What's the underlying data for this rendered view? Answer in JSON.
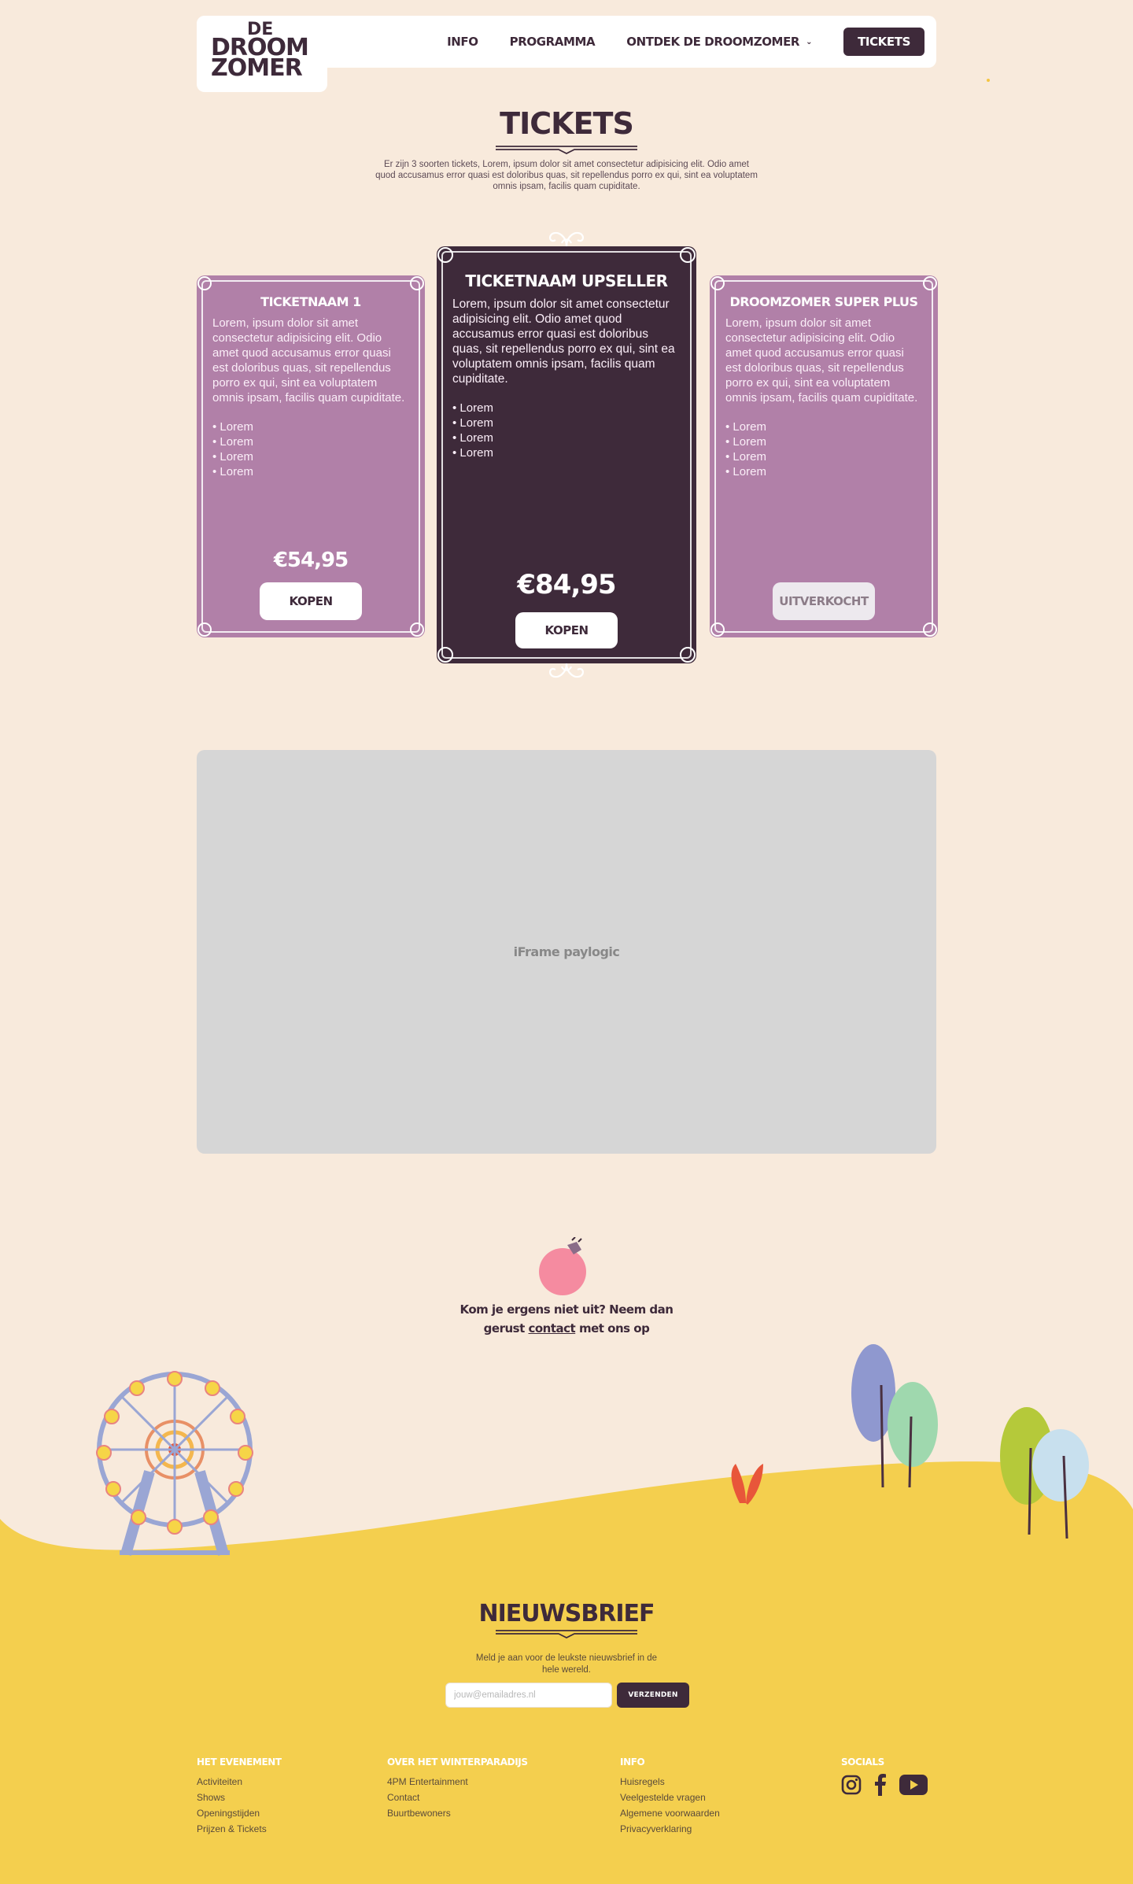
{
  "header": {
    "logo": {
      "line1": "DE",
      "line2": "DROOM",
      "line3": "ZOMER"
    },
    "nav": [
      {
        "label": "INFO"
      },
      {
        "label": "PROGRAMMA"
      },
      {
        "label": "ONTDEK DE DROOMZOMER"
      }
    ],
    "tickets_button": "TICKETS"
  },
  "tickets_section": {
    "title": "TICKETS",
    "intro": "Er zijn 3 soorten tickets, Lorem, ipsum dolor sit amet consectetur adipisicing elit. Odio amet quod accusamus error quasi est doloribus quas, sit repellendus porro ex qui, sint ea voluptatem omnis ipsam, facilis quam cupiditate."
  },
  "cards": [
    {
      "name": "TICKETNAAM 1",
      "description": "Lorem, ipsum dolor sit amet consectetur adipisicing elit. Odio amet quod accusamus error quasi est doloribus quas, sit repellendus porro ex qui, sint ea voluptatem omnis ipsam, facilis quam cupiditate.",
      "bullets": [
        "• Lorem",
        "• Lorem",
        "• Lorem",
        "• Lorem"
      ],
      "price": "€54,95",
      "button": "KOPEN"
    },
    {
      "name": "TICKETNAAM UPSELLER",
      "description": "Lorem, ipsum dolor sit amet consectetur adipisicing elit. Odio amet quod accusamus error quasi est doloribus quas, sit repellendus porro ex qui, sint ea voluptatem omnis ipsam, facilis quam cupiditate.",
      "bullets": [
        "• Lorem",
        "• Lorem",
        "• Lorem",
        "• Lorem"
      ],
      "price": "€84,95",
      "button": "KOPEN"
    },
    {
      "name": "DROOMZOMER SUPER PLUS",
      "description": "Lorem, ipsum dolor sit amet consectetur adipisicing elit. Odio amet quod accusamus error quasi est doloribus quas, sit repellendus porro ex qui, sint ea voluptatem omnis ipsam, facilis quam cupiditate.",
      "bullets": [
        "• Lorem",
        "• Lorem",
        "• Lorem",
        "• Lorem"
      ],
      "price": "",
      "button": "UITVERKOCHT"
    }
  ],
  "iframe": {
    "label": "iFrame paylogic"
  },
  "contact": {
    "line1": "Kom je ergens niet uit? Neem dan",
    "prefix": "gerust ",
    "link": "contact",
    "suffix": " met ons op"
  },
  "newsletter": {
    "title": "NIEUWSBRIEF",
    "text": "Meld je aan voor de leukste nieuwsbrief in de hele wereld.",
    "placeholder": "jouw@emailadres.nl",
    "button": "VERZENDEN"
  },
  "footer": {
    "columns": [
      {
        "title": "HET EVENEMENT",
        "links": [
          "Activiteiten",
          "Shows",
          "Openingstijden",
          "Prijzen & Tickets"
        ]
      },
      {
        "title": "OVER HET WINTERPARADIJS",
        "links": [
          "4PM Entertainment",
          "Contact",
          "Buurtbewoners"
        ]
      },
      {
        "title": "INFO",
        "links": [
          "Huisregels",
          "Veelgestelde vragen",
          "Algemene voorwaarden",
          "Privacyverklaring"
        ]
      }
    ],
    "socials": {
      "title": "SOCIALS",
      "icons": [
        "instagram-icon",
        "facebook-icon",
        "youtube-icon"
      ]
    }
  },
  "colors": {
    "background": "#f8eadc",
    "dark_purple": "#3e2a3a",
    "card_purple": "#b180a8",
    "hill_yellow": "#f4cf4e",
    "iframe_grey": "#d6d6d6"
  }
}
